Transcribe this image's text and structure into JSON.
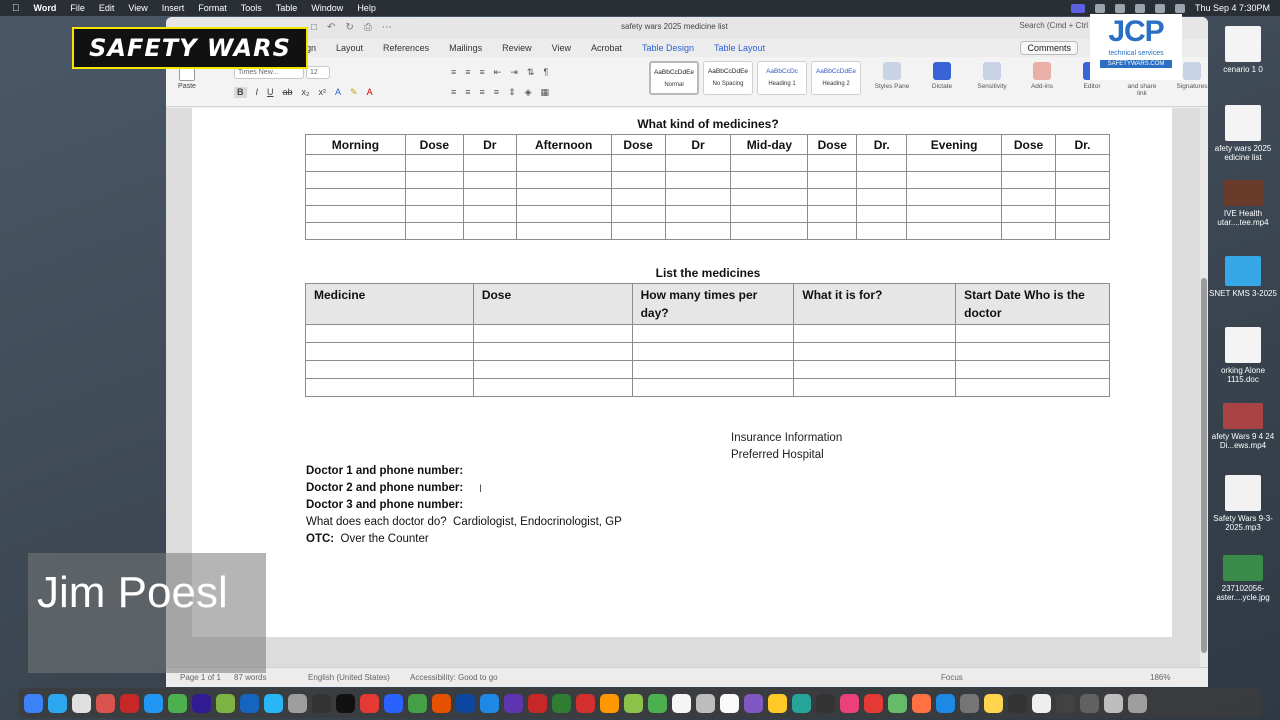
{
  "menubar": {
    "app": "Word",
    "items": [
      "File",
      "Edit",
      "View",
      "Insert",
      "Format",
      "Tools",
      "Table",
      "Window",
      "Help"
    ],
    "clock": "Thu Sep 4  7:30PM"
  },
  "window": {
    "title": "safety wars 2025 medicine list",
    "search_placeholder": "Search (Cmd + Ctrl"
  },
  "ribbon": {
    "tabs": [
      "gn",
      "Layout",
      "References",
      "Mailings",
      "Review",
      "View",
      "Acrobat",
      "Table Design",
      "Table Layout"
    ],
    "comments": "Comments",
    "paste": "Paste",
    "font": "Times New...",
    "size": "12",
    "styles": [
      {
        "preview": "AaBbCcDdEe",
        "label": "Normal"
      },
      {
        "preview": "AaBbCcDdEe",
        "label": "No Spacing"
      },
      {
        "preview": "AaBbCcDc",
        "label": "Heading 1"
      },
      {
        "preview": "AaBbCcDdEe",
        "label": "Heading 2"
      }
    ],
    "buttons": [
      "Styles Pane",
      "Dictate",
      "Sensitivity",
      "Add-ins",
      "Editor",
      "and share link",
      "Signatures"
    ]
  },
  "document": {
    "table1": {
      "heading": "What kind of medicines?",
      "headers": [
        "Morning",
        "Dose",
        "Dr",
        "Afternoon",
        "Dose",
        "Dr",
        "Mid-day",
        "Dose",
        "Dr.",
        "Evening",
        "Dose",
        "Dr."
      ],
      "empty_rows": 5
    },
    "table2": {
      "heading": "List the medicines",
      "headers": [
        "Medicine",
        "Dose",
        "How many times per day?",
        "What it is for?",
        "Start Date Who is the doctor"
      ],
      "empty_rows": 4
    },
    "insurance": "Insurance Information",
    "hospital": "Preferred Hospital",
    "doctor1": "Doctor 1 and phone number:",
    "doctor2": "Doctor 2 and phone number:",
    "doctor3": "Doctor 3 and phone number:",
    "question_label": "What does each doctor do?",
    "question_answer": "Cardiologist, Endocrinologist, GP",
    "otc_label": "OTC:",
    "otc_value": "Over the Counter"
  },
  "statusbar": {
    "page": "Page 1 of 1",
    "words": "87 words",
    "language": "English (United States)",
    "accessibility": "Accessibility: Good to go",
    "focus": "Focus",
    "zoom": "186%"
  },
  "overlays": {
    "safety_wars_logo": "SAFETY WARS",
    "jcp_logo": "JCP",
    "jcp_sub": "technical services",
    "jcp_url": "SAFETYWARS.COM",
    "presenter_name": "Jim Poesl"
  },
  "desktop_icons": [
    {
      "label": "cenario 1 0"
    },
    {
      "label": "afety wars 2025 edicine list"
    },
    {
      "label": "IVE Health utar....tee.mp4"
    },
    {
      "label": "SNET KMS 3-2025"
    },
    {
      "label": "orking Alone 1115.doc"
    },
    {
      "label": "afety Wars 9 4 24 Di...ews.mp4"
    },
    {
      "label": "Safety Wars 9-3-2025.mp3"
    },
    {
      "label": "237102056-aster....ycle.jpg"
    }
  ]
}
